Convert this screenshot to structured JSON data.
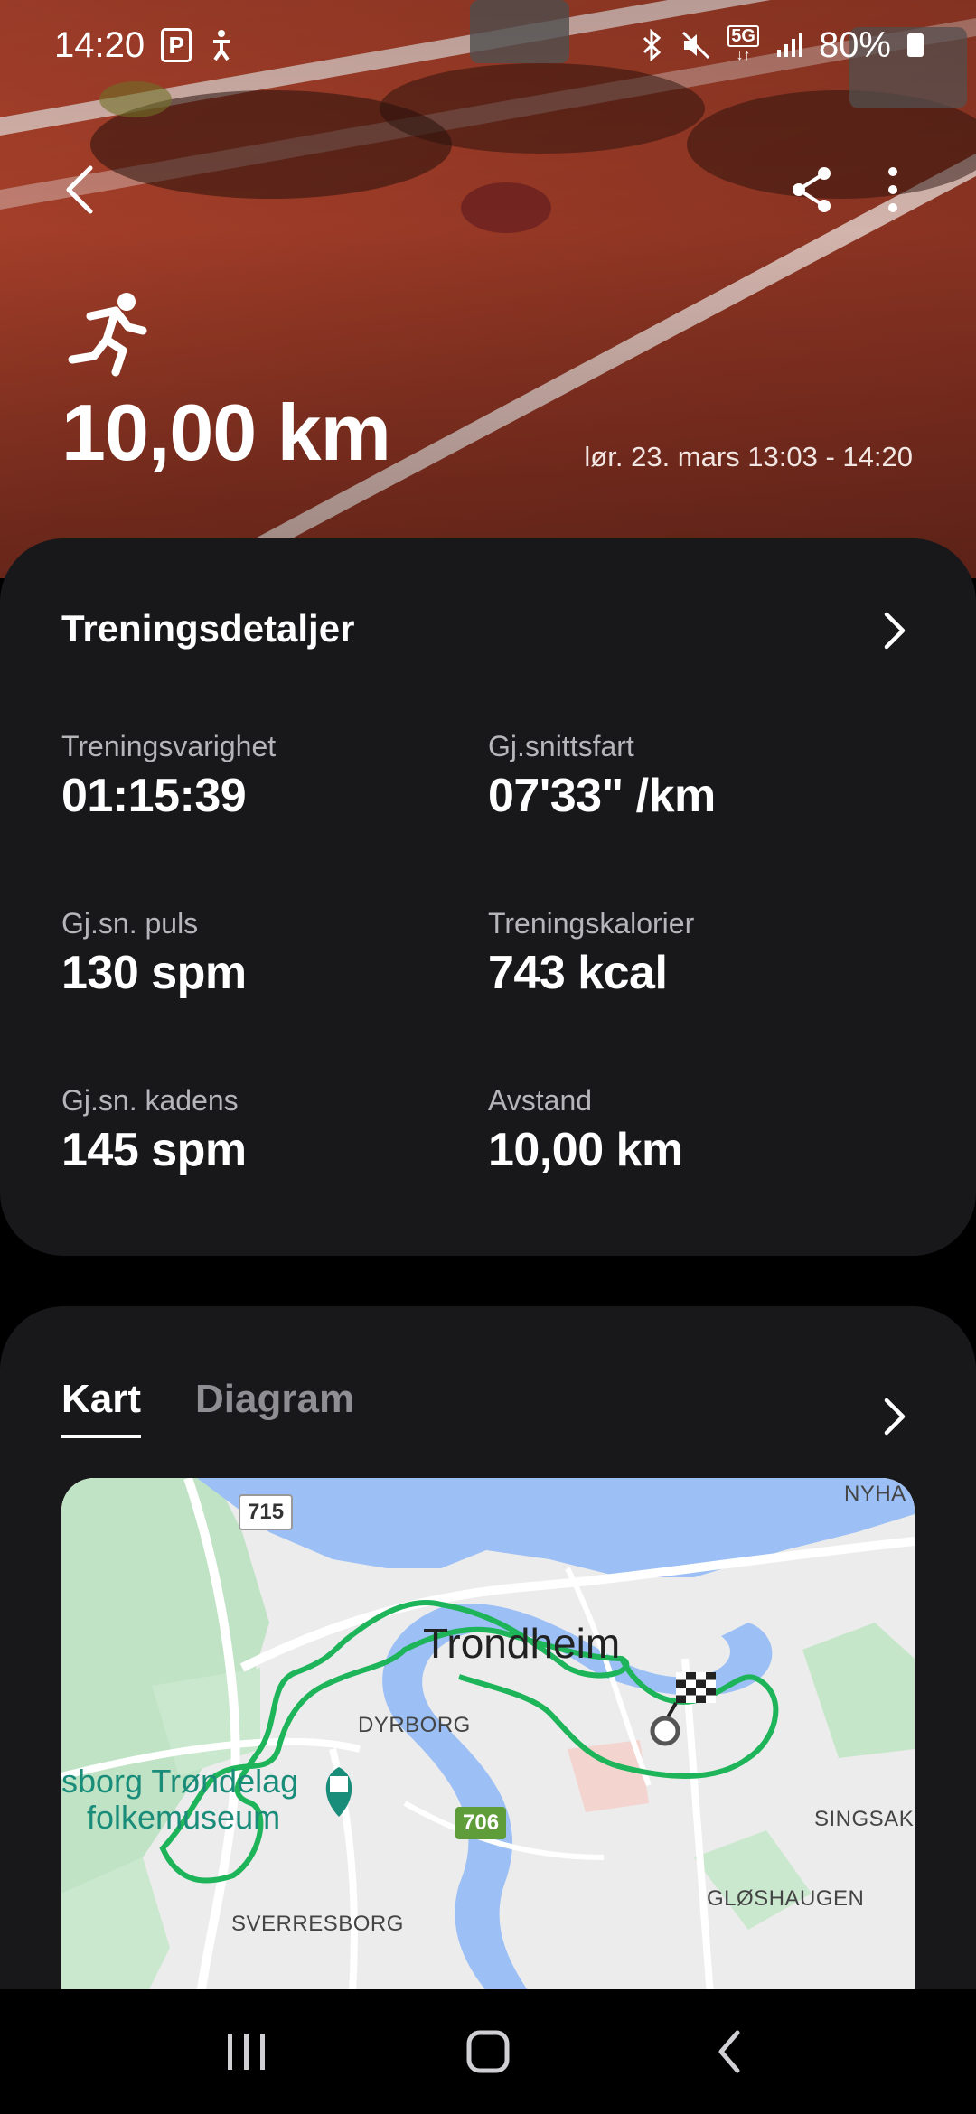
{
  "status_bar": {
    "time": "14:20",
    "left_icons": [
      "parking-icon",
      "accessibility-icon"
    ],
    "right_icons": [
      "bluetooth-icon",
      "mute-icon",
      "5g-icon",
      "signal-icon"
    ],
    "network": "5G",
    "battery": "80%"
  },
  "header": {
    "activity_icon": "running-icon",
    "distance": "10,00 km",
    "date_range": "lør. 23. mars 13:03 - 14:20"
  },
  "details": {
    "title": "Treningsdetaljer",
    "metrics": [
      {
        "label": "Treningsvarighet",
        "value": "01:15:39"
      },
      {
        "label": "Gj.snittsfart",
        "value": "07'33\" /km"
      },
      {
        "label": "Gj.sn. puls",
        "value": "130 spm"
      },
      {
        "label": "Treningskalorier",
        "value": "743 kcal"
      },
      {
        "label": "Gj.sn. kadens",
        "value": "145 spm"
      },
      {
        "label": "Avstand",
        "value": "10,00 km"
      }
    ]
  },
  "map_section": {
    "tabs": [
      {
        "label": "Kart",
        "active": true
      },
      {
        "label": "Diagram",
        "active": false
      }
    ],
    "map": {
      "city": "Trondheim",
      "districts": [
        "DYRBORG",
        "SVERRESBORG",
        "GLØSHAUGEN",
        "SINGSAKE",
        "NYHA"
      ],
      "museum_line1": "sborg Trøndelag",
      "museum_line2": "folkemuseum",
      "roads": [
        "715",
        "706"
      ]
    }
  },
  "colors": {
    "card_bg": "#18181b",
    "route": "#1db45a",
    "water": "#9cc0f5",
    "accent_track": "#a4402b"
  }
}
